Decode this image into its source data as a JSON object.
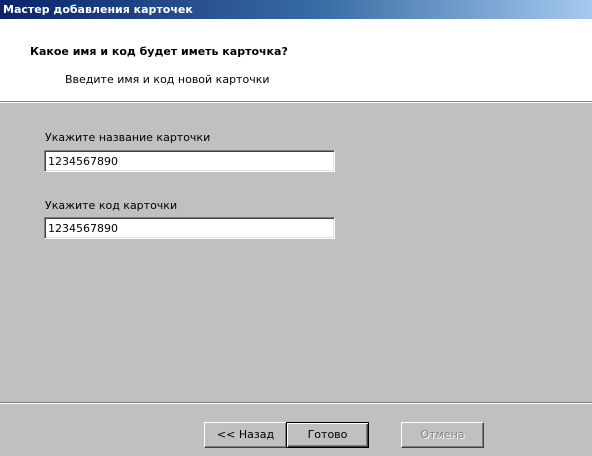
{
  "window": {
    "title": "Мастер добавления карточек"
  },
  "header": {
    "title": "Какое имя и код будет иметь карточка?",
    "subtitle": "Введите имя и код новой карточки"
  },
  "form": {
    "name_label": "Укажите название карточки",
    "name_value": "1234567890",
    "code_label": "Укажите код карточки",
    "code_value": "1234567890"
  },
  "buttons": {
    "back_label": "<< Назад",
    "finish_label": "Готово",
    "cancel_label": "Отмена"
  }
}
